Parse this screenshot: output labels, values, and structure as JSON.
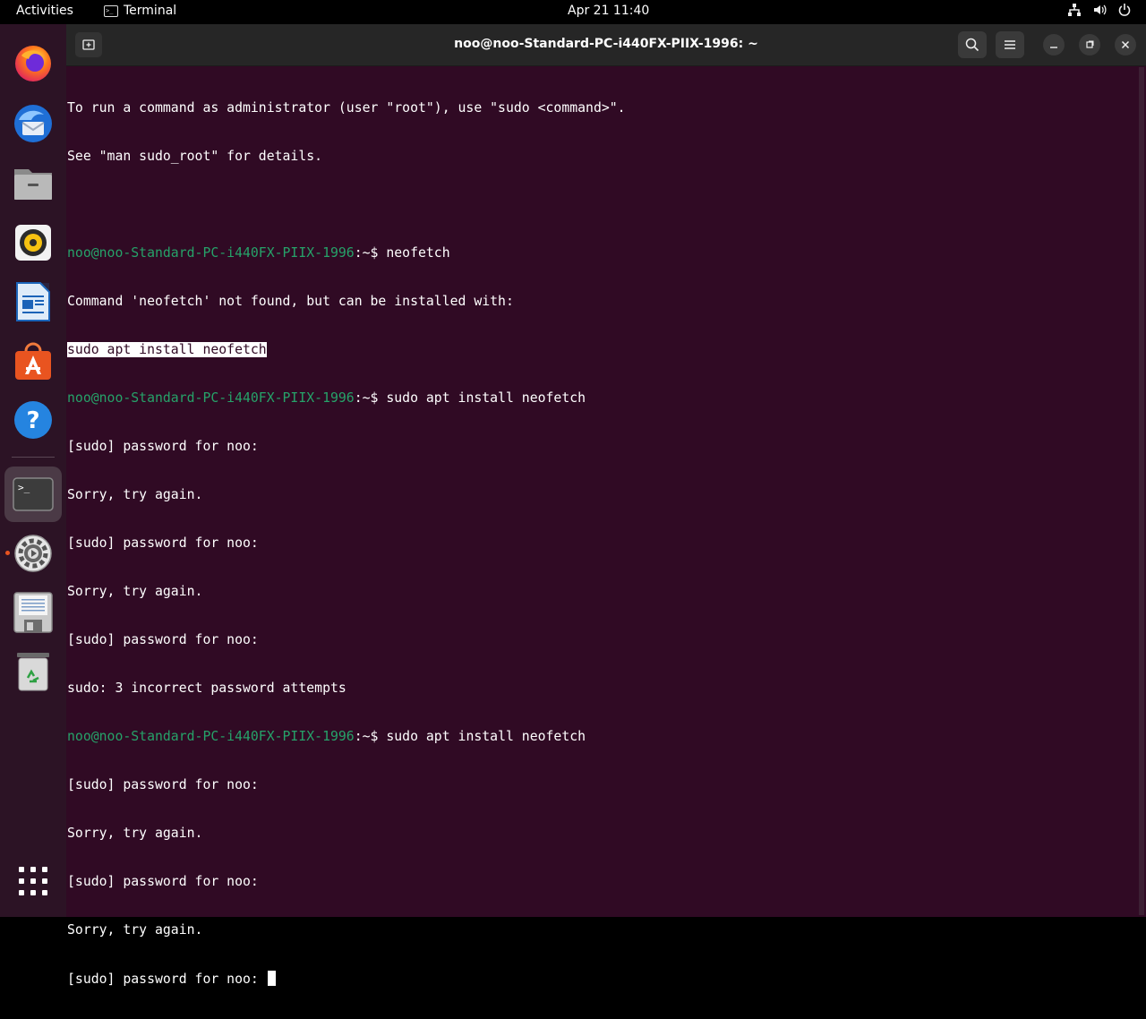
{
  "topbar": {
    "activities": "Activities",
    "app_name": "Terminal",
    "clock": "Apr 21  11:40",
    "terminal_glyph": ">_"
  },
  "dock": {
    "items": [
      {
        "name": "Firefox",
        "icon": "firefox-icon"
      },
      {
        "name": "Thunderbird",
        "icon": "thunderbird-icon"
      },
      {
        "name": "Files",
        "icon": "files-icon"
      },
      {
        "name": "Rhythmbox",
        "icon": "rhythmbox-icon"
      },
      {
        "name": "LibreOffice Writer",
        "icon": "writer-icon"
      },
      {
        "name": "Ubuntu Software",
        "icon": "software-icon"
      },
      {
        "name": "Help",
        "icon": "help-icon"
      },
      {
        "name": "Terminal",
        "icon": "terminal-icon",
        "active": true
      },
      {
        "name": "Settings",
        "icon": "settings-icon"
      },
      {
        "name": "Save",
        "icon": "floppy-icon"
      },
      {
        "name": "Trash",
        "icon": "trash-icon"
      },
      {
        "name": "Show Applications",
        "icon": "app-grid-icon"
      }
    ],
    "help_glyph": "?",
    "terminal_glyph": ">_"
  },
  "window": {
    "title": "noo@noo-Standard-PC-i440FX-PIIX-1996: ~"
  },
  "terminal": {
    "prompt_user": "noo@noo-Standard-PC-i440FX-PIIX-1996",
    "prompt_suffix": ":~$ ",
    "lines": {
      "l0": "To run a command as administrator (user \"root\"), use \"sudo <command>\".",
      "l1": "See \"man sudo_root\" for details.",
      "l2": "",
      "l3_cmd": "neofetch",
      "l4": "Command 'neofetch' not found, but can be installed with:",
      "l5_highlight": "sudo apt install neofetch",
      "l6_cmd": "sudo apt install neofetch",
      "l7": "[sudo] password for noo:",
      "l8": "Sorry, try again.",
      "l9": "[sudo] password for noo:",
      "l10": "Sorry, try again.",
      "l11": "[sudo] password for noo:",
      "l12": "sudo: 3 incorrect password attempts",
      "l13_cmd": "sudo apt install neofetch",
      "l14": "[sudo] password for noo:",
      "l15": "Sorry, try again.",
      "l16": "[sudo] password for noo:",
      "l17": "Sorry, try again.",
      "l18": "[sudo] password for noo: "
    }
  },
  "colors": {
    "terminal_bg": "#300a24",
    "prompt_green": "#26a269",
    "dock_bg": "#2c1325",
    "accent": "#e95420"
  }
}
